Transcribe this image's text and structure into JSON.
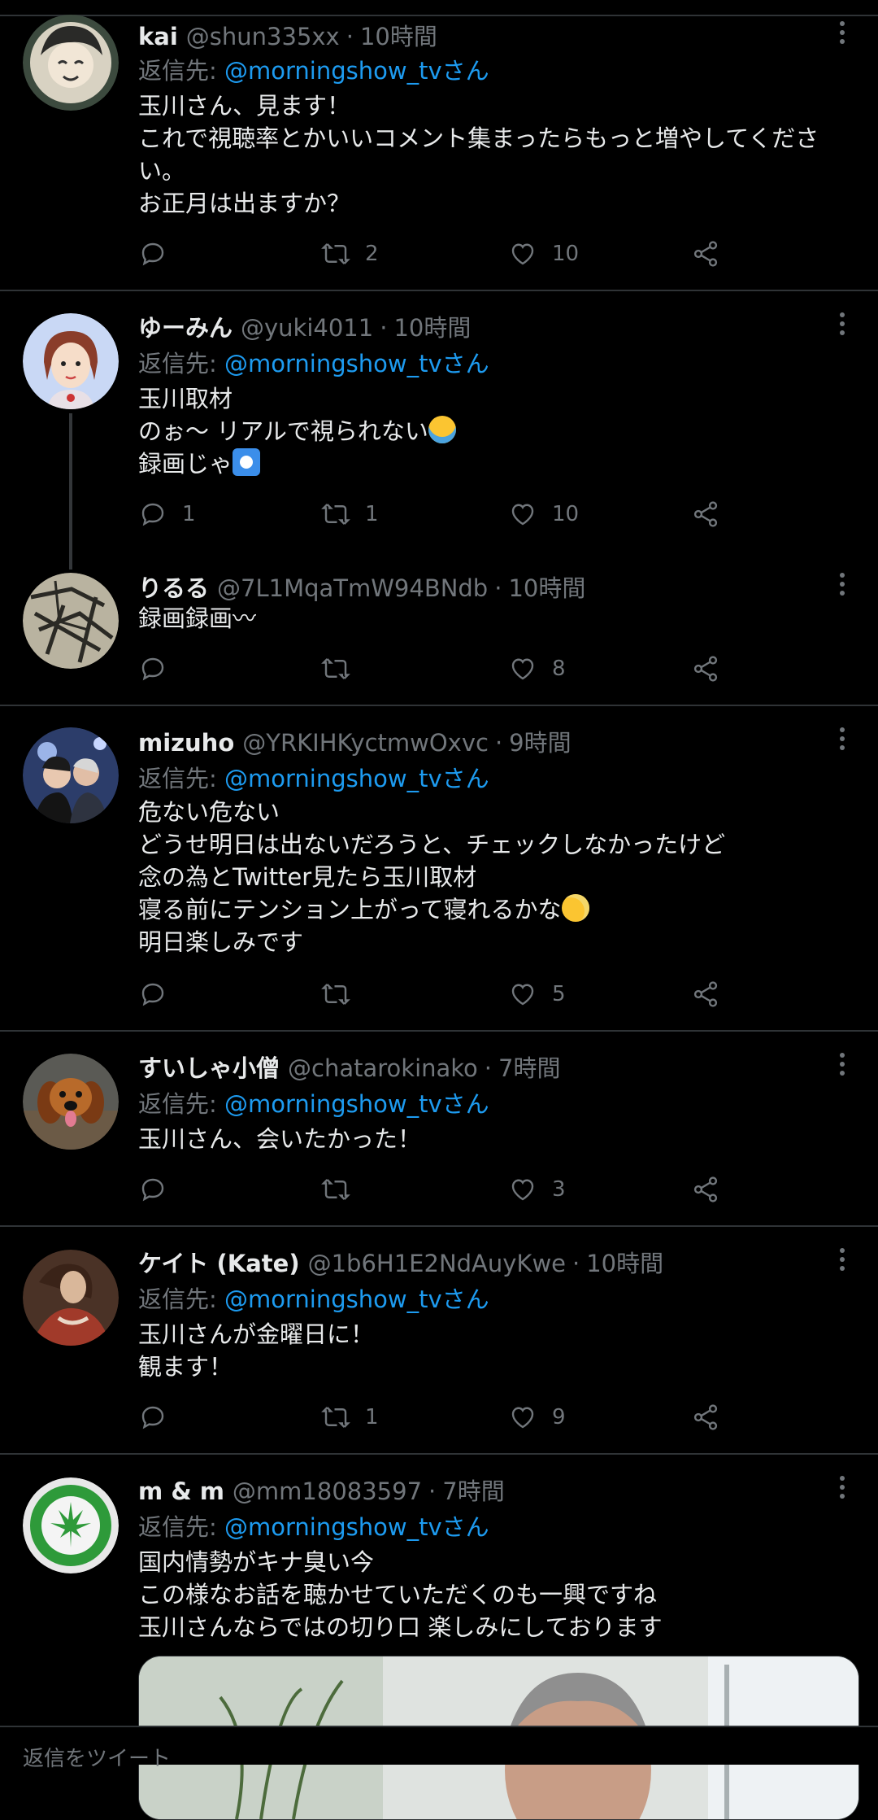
{
  "reply_prefix": "返信先: ",
  "reply_suffix": "さん",
  "tweets": [
    {
      "name": "kai",
      "handle": "@shun335xx",
      "time": "10時間",
      "reply_to": "@morningshow_tv",
      "lines": [
        "玉川さん、見ます！",
        "これで視聴率とかいいコメント集まったらもっと増やしてくださ",
        "い。",
        "お正月は出ますか？"
      ],
      "retweets": "2",
      "likes": "10",
      "replies": ""
    },
    {
      "name": "ゆーみん",
      "handle": "@yuki4011",
      "time": "10時間",
      "reply_to": "@morningshow_tv",
      "lines": [
        "玉川取材",
        "のぉ〜 リアルで視られない",
        "録画じゃ"
      ],
      "emoji": [
        "crying-face",
        "record-button"
      ],
      "replies": "1",
      "retweets": "1",
      "likes": "10"
    },
    {
      "name": "りるる",
      "handle": "@7L1MqaTmW94BNdb",
      "time": "10時間",
      "lines": [
        "録画録画〰"
      ],
      "replies": "",
      "retweets": "",
      "likes": "8"
    },
    {
      "name": "mizuho",
      "handle": "@YRKIHKyctmwOxvc",
      "time": "9時間",
      "reply_to": "@morningshow_tv",
      "lines": [
        "危ない危ない",
        "どうせ明日は出ないだろうと、チェックしなかったけど",
        "念の為とTwitter見たら玉川取材",
        "寝る前にテンション上がって寝れるかな",
        "明日楽しみです"
      ],
      "emoji": [
        "sweat-smile"
      ],
      "replies": "",
      "retweets": "",
      "likes": "5"
    },
    {
      "name": "すいしゃ小僧",
      "handle": "@chatarokinako",
      "time": "7時間",
      "reply_to": "@morningshow_tv",
      "lines": [
        "玉川さん、会いたかった！"
      ],
      "replies": "",
      "retweets": "",
      "likes": "3"
    },
    {
      "name": "ケイト (Kate)",
      "handle": "@1b6H1E2NdAuyKwe",
      "time": "10時間",
      "reply_to": "@morningshow_tv",
      "lines": [
        "玉川さんが金曜日に！",
        "観ます！"
      ],
      "replies": "",
      "retweets": "1",
      "likes": "9"
    },
    {
      "name": "m & m",
      "handle": "@mm18083597",
      "time": "7時間",
      "reply_to": "@morningshow_tv",
      "lines": [
        "国内情勢がキナ臭い今",
        "この様なお話を聴かせていただくのも一興ですね",
        "玉川さんならではの切り口 楽しみにしております"
      ]
    }
  ],
  "bottom_hint": "返信をツイート",
  "colors": {
    "background": "#000000",
    "text": "#e7e9ea",
    "muted": "#71767b",
    "link": "#1d9bf0",
    "divider": "#2f3336"
  },
  "icons": [
    "reply-icon",
    "retweet-icon",
    "like-icon",
    "share-icon",
    "more-icon"
  ]
}
